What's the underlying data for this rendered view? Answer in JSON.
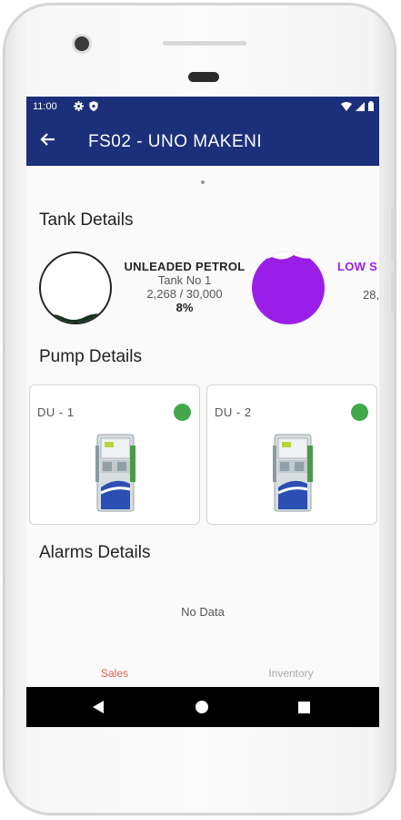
{
  "status_bar": {
    "time": "11:00",
    "left_icons": [
      "gear-icon",
      "shield-icon"
    ],
    "right_icons": [
      "wifi-icon",
      "signal-icon",
      "battery-icon"
    ]
  },
  "app_bar": {
    "back_icon": "arrow-back-icon",
    "title": "FS02 - UNO MAKENI",
    "color": "#1b2f7a"
  },
  "tank_section": {
    "title": "Tank Details",
    "tanks": [
      {
        "name": "UNLEADED PETROL",
        "tank_no": "Tank No 1",
        "volume": "2,268 / 30,000",
        "percent": "8%",
        "fill_color": "#16301c"
      },
      {
        "name": "LOW S",
        "tank_no": "",
        "volume": "28,",
        "percent": "",
        "fill_color": "#9b1ee8",
        "name_color": "#9b1ee8"
      }
    ]
  },
  "pump_section": {
    "title": "Pump Details",
    "pumps": [
      {
        "label": "DU -  1",
        "status_color": "#43a84b",
        "icon": "fuel-pump-icon"
      },
      {
        "label": "DU -  2",
        "status_color": "#43a84b",
        "icon": "fuel-pump-icon"
      }
    ]
  },
  "alarm_section": {
    "title": "Alarms Details",
    "empty_text": "No Data"
  },
  "bottom_tabs": {
    "sales": "Sales",
    "inventory": "Inventory",
    "active_color": "#e85a4f"
  },
  "system_nav": {
    "back_icon": "triangle-back-icon",
    "home_icon": "circle-home-icon",
    "recents_icon": "square-recents-icon"
  }
}
